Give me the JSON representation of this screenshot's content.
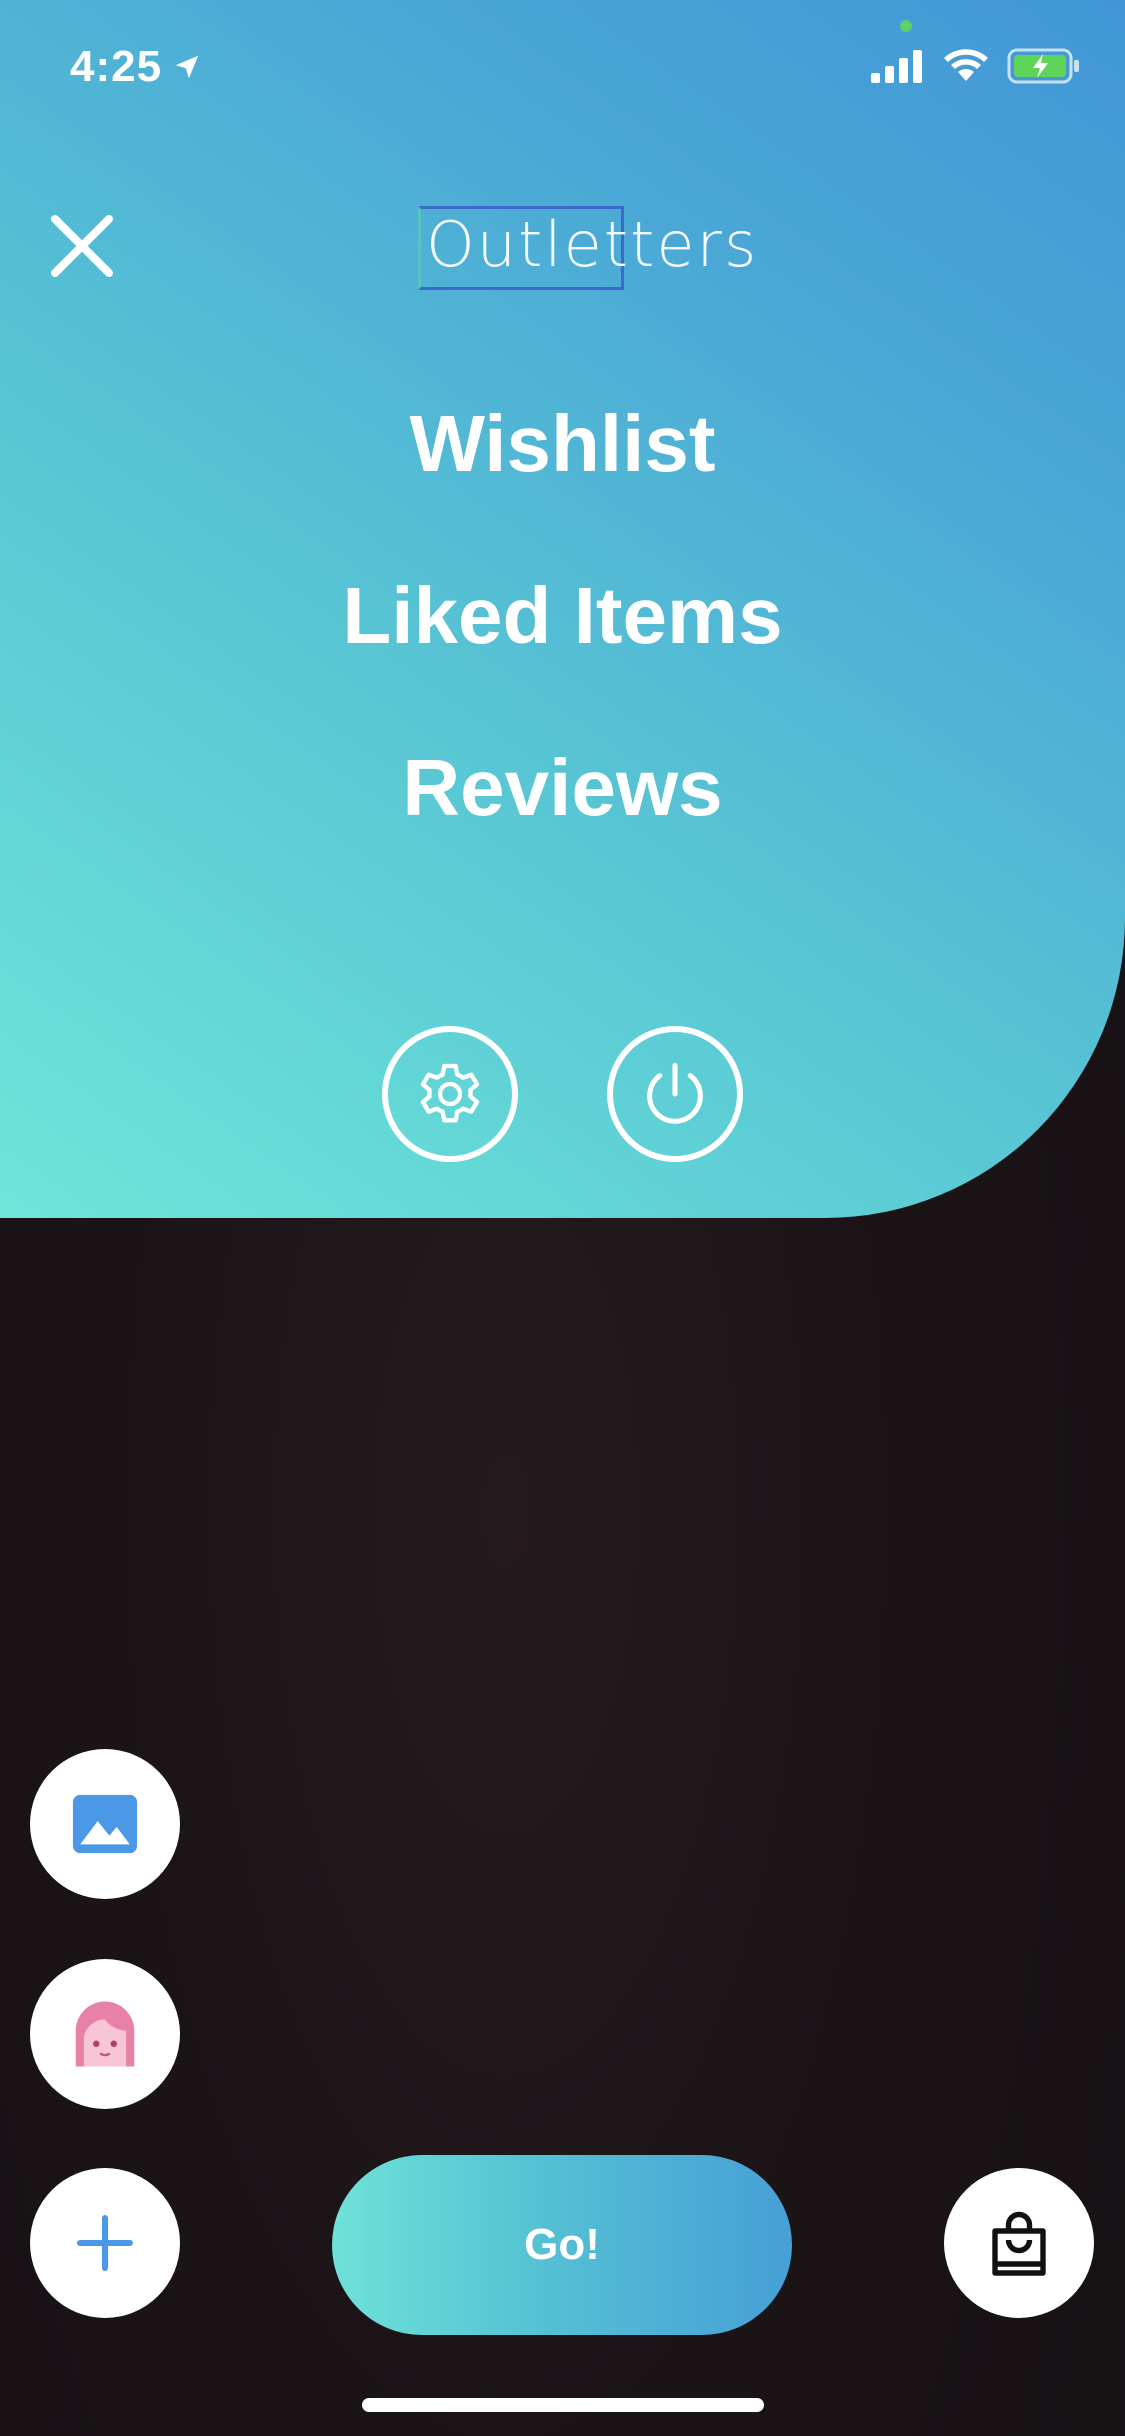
{
  "status_bar": {
    "time": "4:25"
  },
  "header": {
    "logo_text": "Outletters"
  },
  "menu": {
    "items": [
      {
        "label": "Wishlist"
      },
      {
        "label": "Liked Items"
      },
      {
        "label": "Reviews"
      }
    ]
  },
  "actions": {
    "go_label": "Go!"
  },
  "colors": {
    "gradient_start": "#6ee6d9",
    "gradient_end": "#4296d6",
    "photo_icon": "#4a98e6",
    "avatar_icon": "#e880a8",
    "plus_icon": "#4a98e6"
  },
  "icons": {
    "close": "close-icon",
    "settings": "gear-icon",
    "power": "power-icon",
    "photo": "image-icon",
    "avatar": "avatar-icon",
    "add": "plus-icon",
    "bag": "shopping-bag-icon"
  }
}
